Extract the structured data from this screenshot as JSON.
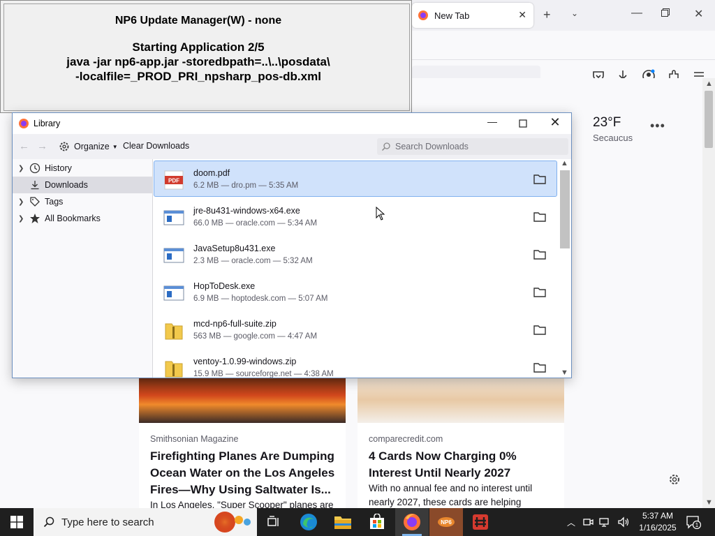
{
  "np6_window": {
    "title": "NP6 Update Manager(W) - none",
    "status_line1": "Starting Application 2/5",
    "status_line2": "java -jar np6-app.jar -storedbpath=..\\..\\posdata\\",
    "status_line3": "-localfile=_PROD_PRI_npsharp_pos-db.xml"
  },
  "browser": {
    "tab_title": "New Tab",
    "weather_temp": "23°F",
    "weather_location": "Secaucus",
    "cards": [
      {
        "source": "Smithsonian Magazine",
        "headline": "Firefighting Planes Are Dumping Ocean Water on the Los Angeles Fires—Why Using Saltwater Is...",
        "snippet": "In Los Angeles, \"Super Scooper\" planes are"
      },
      {
        "source": "comparecredit.com",
        "headline": "4 Cards Now Charging 0% Interest Until Nearly 2027",
        "snippet": "With no annual fee and no interest until nearly 2027, these cards are helping"
      }
    ]
  },
  "library": {
    "title": "Library",
    "organize_label": "Organize",
    "clear_downloads_label": "Clear Downloads",
    "search_placeholder": "Search Downloads",
    "sidebar": [
      {
        "label": "History"
      },
      {
        "label": "Downloads"
      },
      {
        "label": "Tags"
      },
      {
        "label": "All Bookmarks"
      }
    ],
    "downloads": [
      {
        "name": "doom.pdf",
        "meta": "6.2 MB — dro.pm — 5:35 AM",
        "type": "pdf"
      },
      {
        "name": "jre-8u431-windows-x64.exe",
        "meta": "66.0 MB — oracle.com — 5:34 AM",
        "type": "exe"
      },
      {
        "name": "JavaSetup8u431.exe",
        "meta": "2.3 MB — oracle.com — 5:32 AM",
        "type": "exe"
      },
      {
        "name": "HopToDesk.exe",
        "meta": "6.9 MB — hoptodesk.com — 5:07 AM",
        "type": "exe"
      },
      {
        "name": "mcd-np6-full-suite.zip",
        "meta": "563 MB — google.com — 4:47 AM",
        "type": "zip"
      },
      {
        "name": "ventoy-1.0.99-windows.zip",
        "meta": "15.9 MB — sourceforge.net — 4:38 AM",
        "type": "zip"
      }
    ]
  },
  "taskbar": {
    "search_placeholder": "Type here to search",
    "time": "5:37 AM",
    "date": "1/16/2025",
    "notification_count": "1"
  },
  "colors": {
    "selection_bg": "#d0e2fb",
    "taskbar_bg": "#1f1f1f",
    "accent": "#7fb5ec"
  }
}
